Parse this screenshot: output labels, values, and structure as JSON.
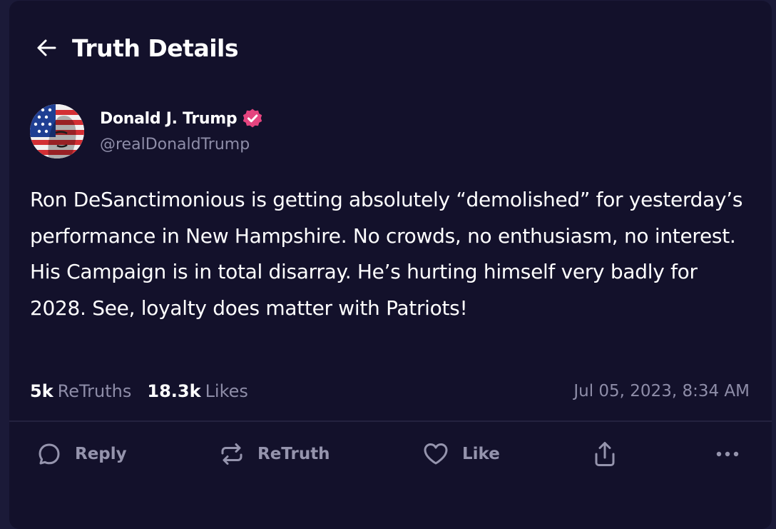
{
  "header": {
    "title": "Truth Details",
    "back_icon": "arrow-left-icon"
  },
  "author": {
    "display_name": "Donald J. Trump",
    "handle": "@realDonaldTrump",
    "verified": true,
    "verified_color": "#e5447f"
  },
  "post": {
    "text": "Ron DeSanctimonious is getting absolutely “demolished” for yesterday’s performance in New Hampshire. No crowds, no enthusiasm, no interest. His Campaign is in total disarray. He’s hurting himself very badly for 2028. See, loyalty does matter with Patriots!"
  },
  "stats": {
    "retruths_count": "5k",
    "retruths_label": "ReTruths",
    "likes_count": "18.3k",
    "likes_label": "Likes",
    "timestamp": "Jul 05, 2023, 8:34 AM"
  },
  "actions": {
    "reply_label": "Reply",
    "retruth_label": "ReTruth",
    "like_label": "Like",
    "icons": [
      "comment-icon",
      "retruth-icon",
      "heart-icon",
      "share-icon",
      "more-icon"
    ]
  },
  "colors": {
    "page_bg": "#1b1a38",
    "card_bg": "#13112b",
    "muted_text": "#8e8da8"
  }
}
